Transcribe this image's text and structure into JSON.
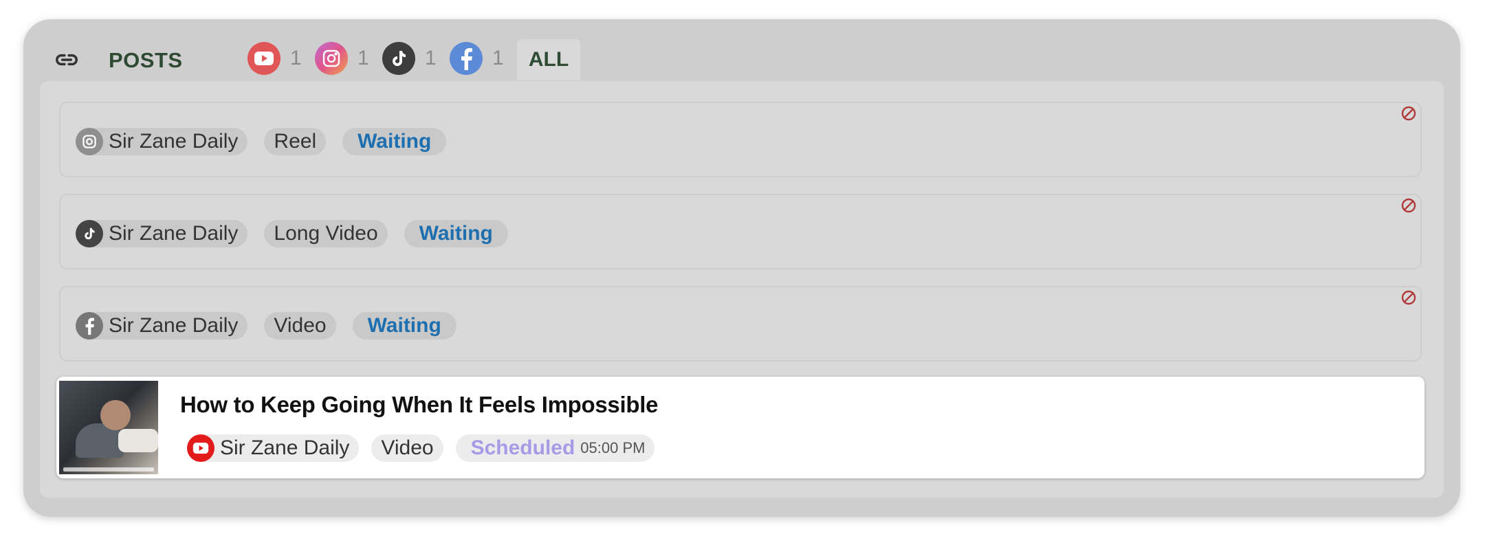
{
  "header": {
    "title": "POSTS",
    "platform_counts": [
      {
        "platform": "youtube-icon",
        "count": "1",
        "color": "#e05555"
      },
      {
        "platform": "instagram-icon",
        "count": "1",
        "color": "#d9537f"
      },
      {
        "platform": "tiktok-icon",
        "count": "1",
        "color": "#3d3d3d"
      },
      {
        "platform": "facebook-icon",
        "count": "1",
        "color": "#5b8ad6"
      }
    ],
    "all_tab": "ALL"
  },
  "posts": [
    {
      "account": "Sir Zane Daily",
      "platform": "instagram-icon",
      "type": "Reel",
      "status": "Waiting"
    },
    {
      "account": "Sir Zane Daily",
      "platform": "tiktok-icon",
      "type": "Long Video",
      "status": "Waiting"
    },
    {
      "account": "Sir Zane Daily",
      "platform": "facebook-icon",
      "type": "Video",
      "status": "Waiting"
    }
  ],
  "scheduled_post": {
    "title": "How to Keep Going When It Feels Impossible",
    "account": "Sir Zane Daily",
    "platform": "youtube-icon",
    "type": "Video",
    "status": "Scheduled",
    "time": "05:00 PM"
  },
  "colors": {
    "status_waiting": "#1e6fb0",
    "status_scheduled": "#a79ae6",
    "title_green": "#2e4a33",
    "block_red": "#b03a3a"
  }
}
